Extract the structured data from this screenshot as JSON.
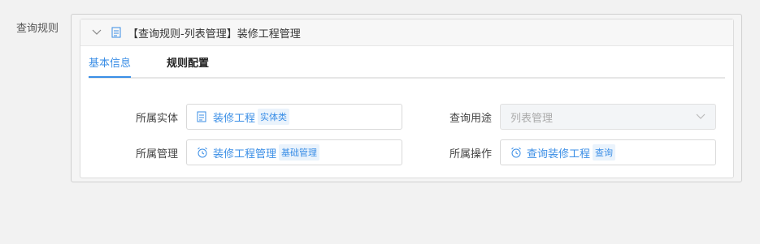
{
  "field_label": "查询规则",
  "panel": {
    "title": "【查询规则-列表管理】装修工程管理"
  },
  "tabs": [
    {
      "label": "基本信息",
      "active": true
    },
    {
      "label": "规则配置",
      "active": false
    }
  ],
  "rows": {
    "entity": {
      "label": "所属实体",
      "value": "装修工程",
      "tag": "实体类",
      "icon": "document-icon"
    },
    "usage": {
      "label": "查询用途",
      "value": "列表管理",
      "icon": "chevron-down-icon"
    },
    "management": {
      "label": "所属管理",
      "value": "装修工程管理",
      "tag": "基础管理",
      "icon": "alarm-clock-icon"
    },
    "operation": {
      "label": "所属操作",
      "value": "查询装修工程",
      "tag": "查询",
      "icon": "alarm-clock-icon"
    }
  },
  "colors": {
    "accent": "#3a8ee6",
    "tag_bg": "#eaf3fc"
  }
}
